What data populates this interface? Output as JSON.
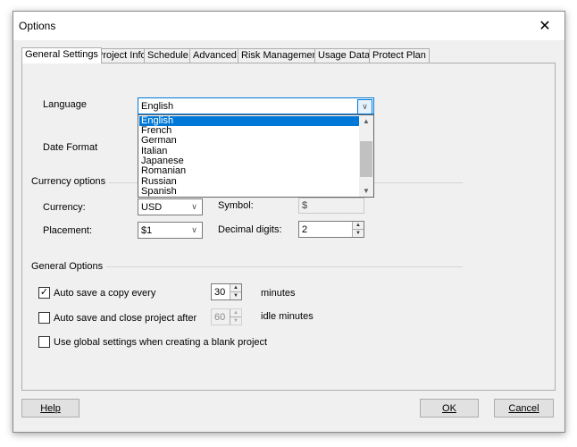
{
  "window": {
    "title": "Options"
  },
  "tabs": [
    "General Settings",
    "Project Info",
    "Schedule",
    "Advanced",
    "Risk Management",
    "Usage Data",
    "Protect Plan"
  ],
  "language": {
    "label": "Language",
    "selected": "English",
    "options": [
      "English",
      "French",
      "German",
      "Italian",
      "Japanese",
      "Romanian",
      "Russian",
      "Spanish"
    ]
  },
  "date_format": {
    "label": "Date Format"
  },
  "currency_options": {
    "group_title": "Currency options",
    "currency_label": "Currency:",
    "currency_value": "USD",
    "symbol_label": "Symbol:",
    "symbol_value": "$",
    "placement_label": "Placement:",
    "placement_value": "$1",
    "decimal_label": "Decimal digits:",
    "decimal_value": "2"
  },
  "general_options": {
    "group_title": "General Options",
    "autosave_label": "Auto save a copy every",
    "autosave_checked": true,
    "autosave_value": "30",
    "autosave_unit": "minutes",
    "autoclose_label": "Auto save and close project after",
    "autoclose_checked": false,
    "autoclose_value": "60",
    "autoclose_unit": "idle minutes",
    "global_label": "Use global settings when creating a blank project",
    "global_checked": false
  },
  "buttons": {
    "help": "Help",
    "ok": "OK",
    "cancel": "Cancel"
  }
}
